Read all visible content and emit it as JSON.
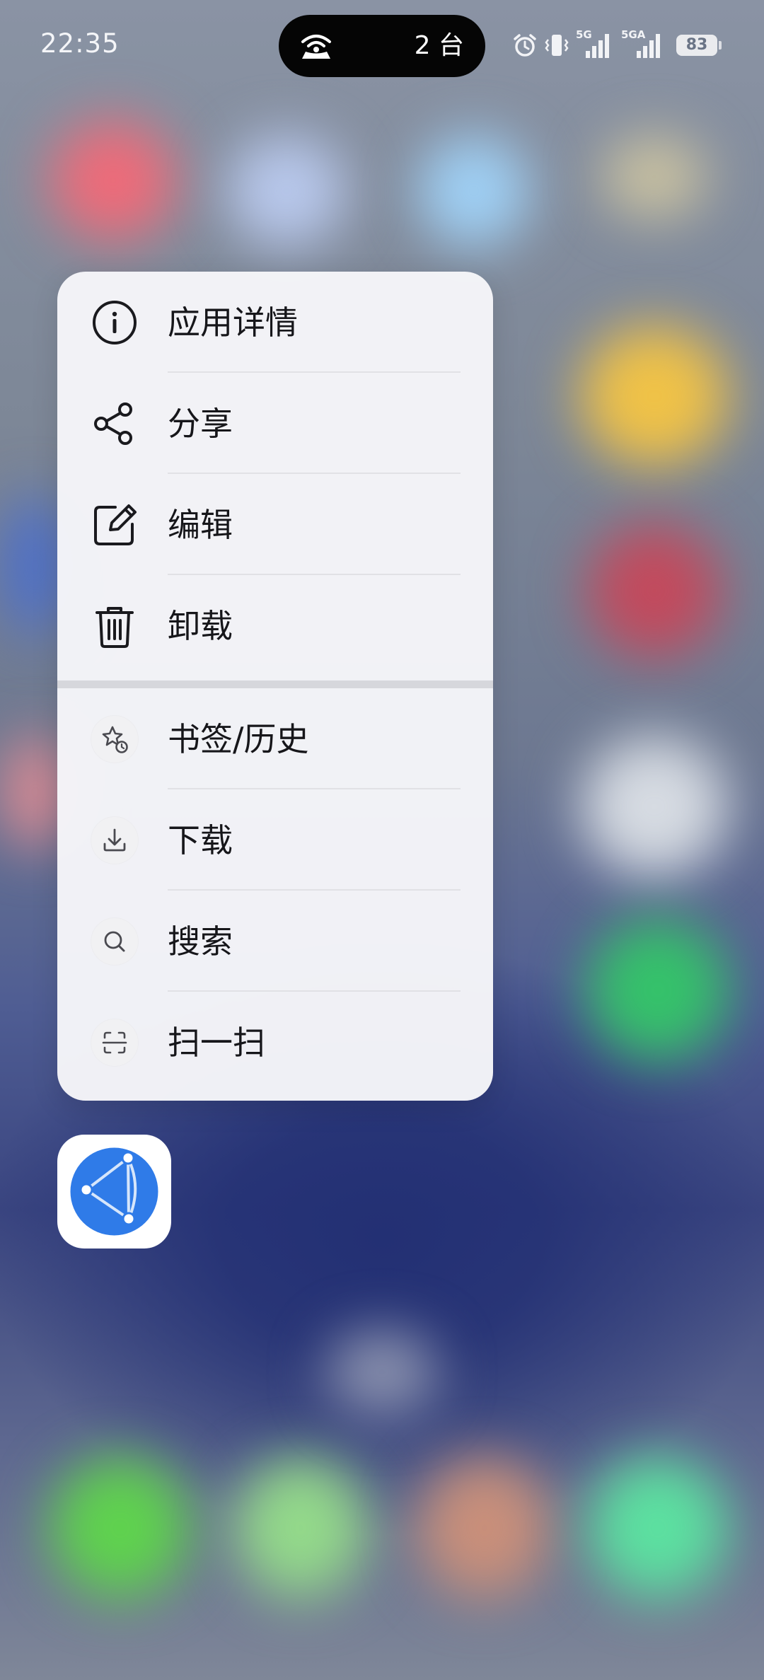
{
  "status_bar": {
    "time": "22:35",
    "island_count": "2 台",
    "battery": "83",
    "net1": "5G",
    "net2": "5GA",
    "icons": [
      "hotspot-icon",
      "alarm-icon",
      "vibrate-icon",
      "signal-icon",
      "signal-icon",
      "battery-icon"
    ]
  },
  "menu": {
    "items": [
      {
        "label": "应用详情",
        "icon": "info-icon"
      },
      {
        "label": "分享",
        "icon": "share-icon"
      },
      {
        "label": "编辑",
        "icon": "edit-icon"
      },
      {
        "label": "卸载",
        "icon": "trash-icon"
      },
      {
        "label": "书签/历史",
        "icon": "bookmark-history-icon"
      },
      {
        "label": "下载",
        "icon": "download-icon"
      },
      {
        "label": "搜索",
        "icon": "search-icon"
      },
      {
        "label": "扫一扫",
        "icon": "scan-icon"
      }
    ]
  },
  "app": {
    "icon": "browser-globe-icon",
    "brand_color": "#2f7be8"
  }
}
